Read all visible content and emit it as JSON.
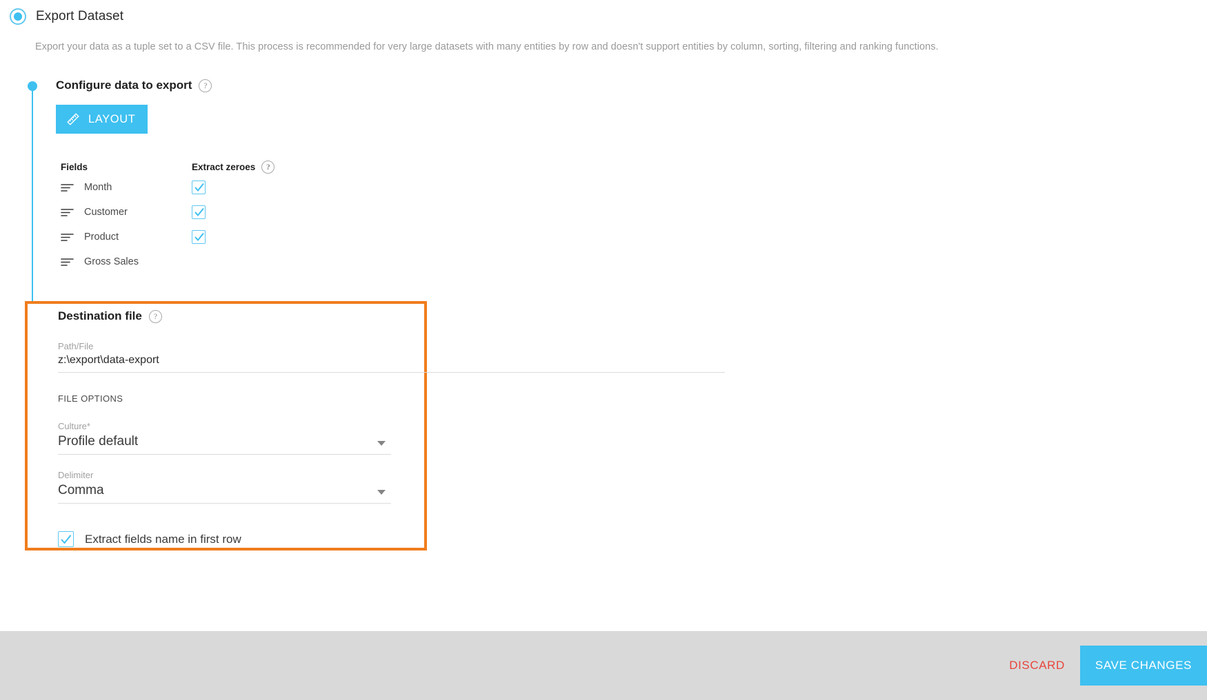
{
  "header": {
    "title": "Export Dataset",
    "radio_selected": true,
    "description": "Export your data as a tuple set to a CSV file. This process is recommended for very large datasets with many entities by row and doesn't support entities by column, sorting, filtering and ranking functions."
  },
  "colors": {
    "accent_blue": "#3ec0f0",
    "highlight_orange": "#f07d1e",
    "discard_red": "#e8453c",
    "footer_gray": "#d9d9d9"
  },
  "configure_section": {
    "title": "Configure data to export",
    "help_glyph": "?",
    "layout_button": "LAYOUT",
    "layout_icon": "ruler-icon",
    "table": {
      "columns": [
        "Fields",
        "Extract zeroes"
      ],
      "rows": [
        {
          "name": "Month",
          "icon": "field-lines-icon",
          "extract_zeroes": true,
          "has_checkbox": true
        },
        {
          "name": "Customer",
          "icon": "field-lines-icon",
          "extract_zeroes": true,
          "has_checkbox": true
        },
        {
          "name": "Product",
          "icon": "field-lines-icon",
          "extract_zeroes": true,
          "has_checkbox": true
        },
        {
          "name": "Gross Sales",
          "icon": "field-lines-icon",
          "extract_zeroes": false,
          "has_checkbox": false
        }
      ]
    }
  },
  "destination_section": {
    "title": "Destination file",
    "help_glyph": "?",
    "path_label": "Path/File",
    "path_value": "z:\\export\\data-export",
    "file_options_label": "FILE OPTIONS",
    "culture_label": "Culture",
    "culture_required_mark": "*",
    "culture_value": "Profile default",
    "delimiter_label": "Delimiter",
    "delimiter_value": "Comma",
    "extract_fields_label": "Extract fields name in first row",
    "extract_fields_checked": true
  },
  "footer": {
    "discard_label": "DISCARD",
    "save_label": "SAVE CHANGES"
  }
}
